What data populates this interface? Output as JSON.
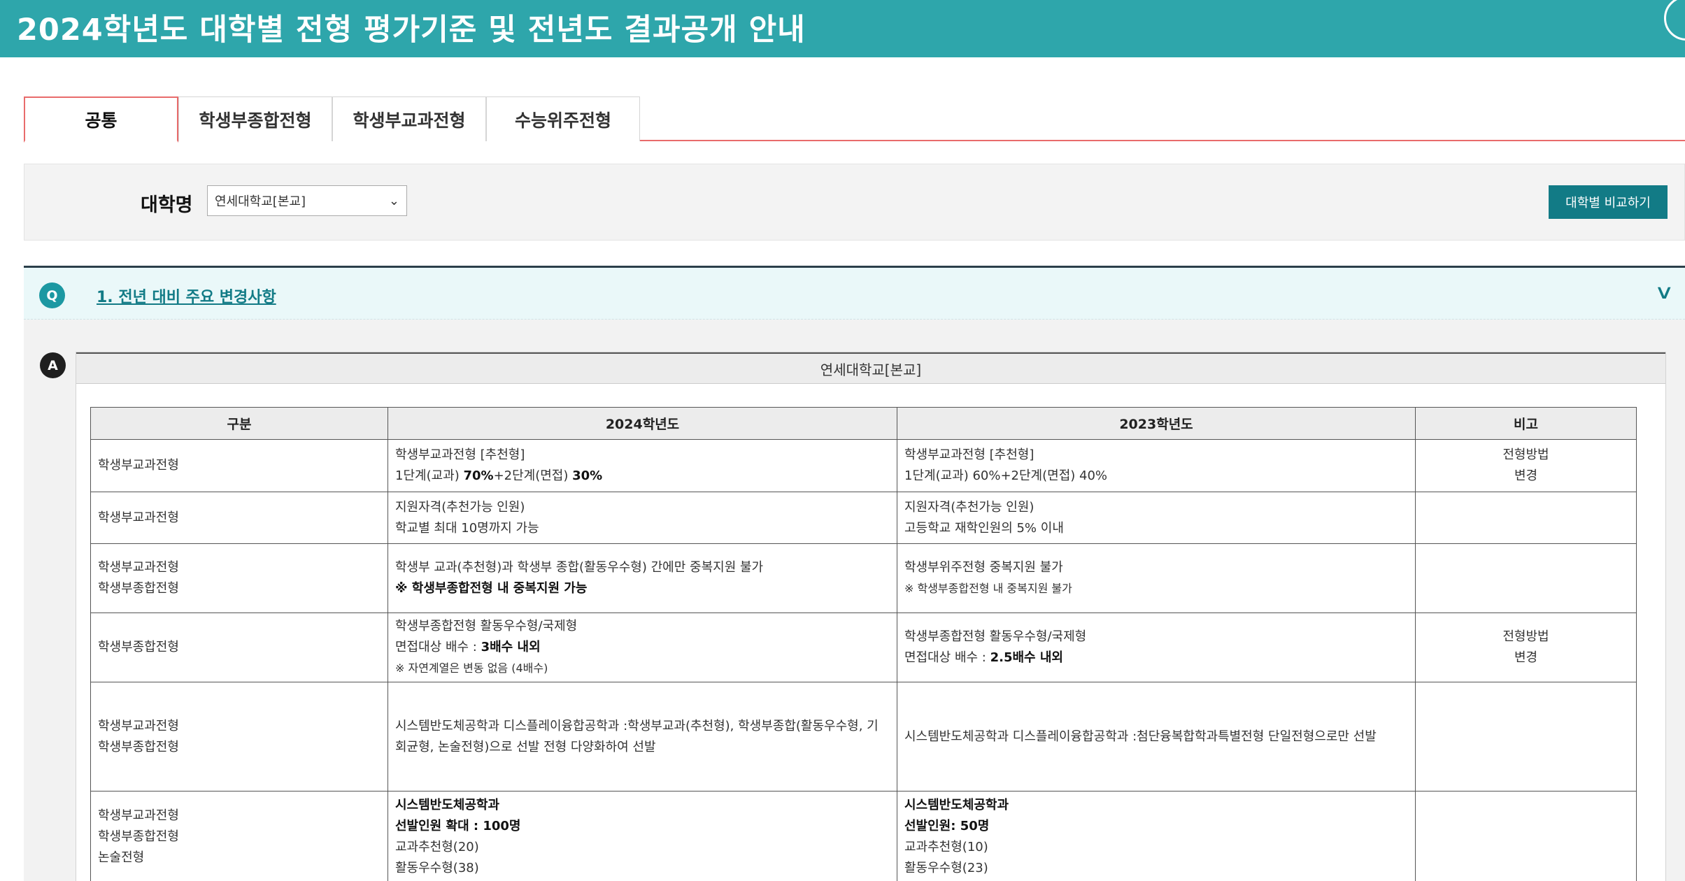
{
  "header": {
    "title": "2024학년도 대학별 전형 평가기준 및 전년도 결과공개 안내"
  },
  "tabs": [
    {
      "label": "공통",
      "active": true
    },
    {
      "label": "학생부종합전형",
      "active": false
    },
    {
      "label": "학생부교과전형",
      "active": false
    },
    {
      "label": "수능위주전형",
      "active": false
    }
  ],
  "search": {
    "label": "대학명",
    "selected_university": "연세대학교[본교]",
    "compare_button": "대학별 비교하기"
  },
  "question": {
    "badge": "Q",
    "title": "1. 전년 대비 주요 변경사항"
  },
  "answer": {
    "badge": "A",
    "university": "연세대학교[본교]",
    "table": {
      "headers": [
        "구분",
        "2024학년도",
        "2023학년도",
        "비고"
      ],
      "rows": [
        {
          "category": [
            "학생부교과전형"
          ],
          "y2024": [
            [
              {
                "t": "학생부교과전형 [추천형]"
              }
            ],
            [
              {
                "t": "1단계(교과) "
              },
              {
                "t": "70%",
                "b": true
              },
              {
                "t": "+2단계(면접) "
              },
              {
                "t": "30%",
                "b": true
              }
            ]
          ],
          "y2023": [
            [
              {
                "t": "학생부교과전형 [추천형]"
              }
            ],
            [
              {
                "t": "1단계(교과) 60%+2단계(면접) 40%"
              }
            ]
          ],
          "note": [
            "전형방법",
            "변경"
          ]
        },
        {
          "category": [
            "학생부교과전형"
          ],
          "y2024": [
            [
              {
                "t": "지원자격(추천가능 인원)"
              }
            ],
            [
              {
                "t": "학교별 최대 10명까지 가능"
              }
            ]
          ],
          "y2023": [
            [
              {
                "t": "지원자격(추천가능 인원)"
              }
            ],
            [
              {
                "t": "고등학교 재학인원의 5% 이내"
              }
            ]
          ],
          "note": []
        },
        {
          "category": [
            "학생부교과전형",
            "학생부종합전형"
          ],
          "y2024": [
            [
              {
                "t": "학생부 교과(추천형)과 학생부 종합(활동우수형) 간에만 중복지원 불가"
              }
            ],
            [
              {
                "t": "※ 학생부종합전형 내 중복지원 가능",
                "b": true
              }
            ]
          ],
          "y2023": [
            [
              {
                "t": "학생부위주전형 중복지원 불가"
              }
            ],
            [
              {
                "t": "※ 학생부종합전형 내 중복지원 불가",
                "s": true
              }
            ]
          ],
          "note": []
        },
        {
          "category": [
            "학생부종합전형"
          ],
          "y2024": [
            [
              {
                "t": "학생부종합전형 활동우수형/국제형"
              }
            ],
            [
              {
                "t": "면접대상 배수 : "
              },
              {
                "t": "3배수 내외",
                "b": true
              }
            ],
            [
              {
                "t": "※ 자연계열은 변동 없음 (4배수)",
                "s": true
              }
            ]
          ],
          "y2023": [
            [
              {
                "t": "학생부종합전형 활동우수형/국제형"
              }
            ],
            [
              {
                "t": "면접대상 배수 : "
              },
              {
                "t": "2.5배수 내외",
                "b": true
              }
            ]
          ],
          "note": [
            "전형방법",
            "변경"
          ]
        },
        {
          "category": [
            "학생부교과전형",
            "학생부종합전형"
          ],
          "y2024": [
            [
              {
                "t": "시스템반도체공학과  디스플레이융합공학과 :학생부교과(추천형),  학생부종합(활동우수형, 기회균형, 논술전형)으로 선발 전형 다양화하여 선발"
              }
            ]
          ],
          "y2023": [
            [
              {
                "t": "시스템반도체공학과  디스플레이융합공학과 :첨단융복합학과특별전형 단일전형으로만 선발"
              }
            ]
          ],
          "note": []
        },
        {
          "category": [
            "학생부교과전형",
            "학생부종합전형",
            "논술전형"
          ],
          "y2024": [
            [
              {
                "t": "시스템반도체공학과",
                "b": true
              }
            ],
            [
              {
                "t": "선발인원 확대 : 100명",
                "b": true
              }
            ],
            [
              {
                "t": "교과추천형(20)"
              }
            ],
            [
              {
                "t": "활동우수형(38)"
              }
            ]
          ],
          "y2023": [
            [
              {
                "t": "시스템반도체공학과",
                "b": true
              }
            ],
            [
              {
                "t": "선발인원: 50명",
                "b": true
              }
            ],
            [
              {
                "t": "교과추천형(10)"
              }
            ],
            [
              {
                "t": "활동우수형(23)"
              }
            ]
          ],
          "note": []
        }
      ]
    }
  }
}
